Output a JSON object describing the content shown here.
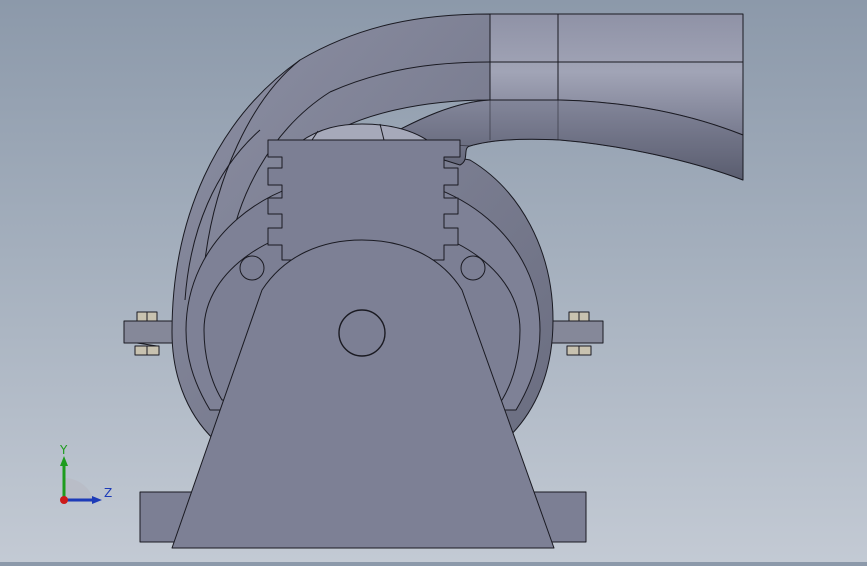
{
  "scene": {
    "part": "blower-housing-model",
    "view": "front"
  },
  "triad": {
    "y_label": "Y",
    "z_label": "Z",
    "colors": {
      "y": "#1e9c1e",
      "z": "#1d3bb8",
      "x": "#cc1a1a"
    }
  },
  "colors": {
    "body": "#7c7f94",
    "body_light": "#9598ab",
    "duct_light": "#a2a5b7",
    "duct_dark": "#5f6275",
    "edge": "#1a1a22",
    "bolt": "#c8c2b0"
  }
}
